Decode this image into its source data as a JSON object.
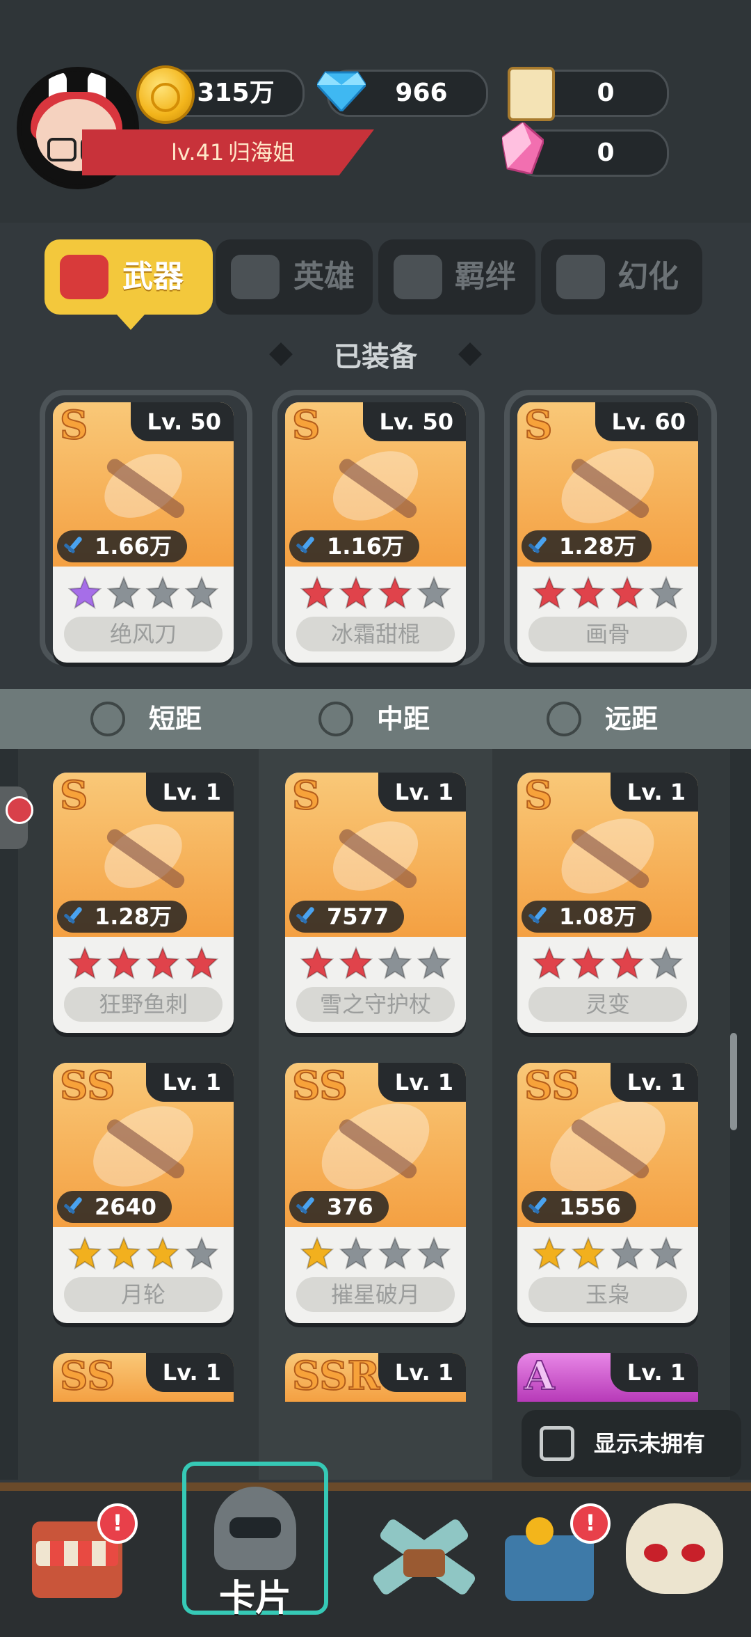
{
  "header": {
    "gold": "315万",
    "diamonds": "966",
    "scrolls": "0",
    "crystals": "0",
    "player_level": "lv.41",
    "player_name": "归海姐"
  },
  "tabs": [
    {
      "label": "武器",
      "active": true
    },
    {
      "label": "英雄",
      "active": false
    },
    {
      "label": "羁绊",
      "active": false
    },
    {
      "label": "幻化",
      "active": false
    }
  ],
  "equipped_title": "已装备",
  "equipped": [
    {
      "grade": "S",
      "level": "Lv. 50",
      "power": "1.66万",
      "stars_filled": 1,
      "star_color": "purple",
      "name": "绝风刀"
    },
    {
      "grade": "S",
      "level": "Lv. 50",
      "power": "1.16万",
      "stars_filled": 3,
      "star_color": "red",
      "name": "冰霜甜棍"
    },
    {
      "grade": "S",
      "level": "Lv. 60",
      "power": "1.28万",
      "stars_filled": 3,
      "star_color": "red",
      "name": "画骨"
    }
  ],
  "ranges": [
    "短距",
    "中距",
    "远距"
  ],
  "weapons": [
    {
      "grade": "S",
      "level": "Lv. 1",
      "power": "1.28万",
      "stars_filled": 4,
      "star_color": "red",
      "name": "狂野鱼刺"
    },
    {
      "grade": "S",
      "level": "Lv. 1",
      "power": "7577",
      "stars_filled": 2,
      "star_color": "red",
      "name": "雪之守护杖"
    },
    {
      "grade": "S",
      "level": "Lv. 1",
      "power": "1.08万",
      "stars_filled": 3,
      "star_color": "red",
      "name": "灵变"
    },
    {
      "grade": "SS",
      "level": "Lv. 1",
      "power": "2640",
      "stars_filled": 3,
      "star_color": "gold",
      "name": "月轮"
    },
    {
      "grade": "SS",
      "level": "Lv. 1",
      "power": "376",
      "stars_filled": 1,
      "star_color": "gold",
      "name": "摧星破月"
    },
    {
      "grade": "SS",
      "level": "Lv. 1",
      "power": "1556",
      "stars_filled": 2,
      "star_color": "gold",
      "name": "玉枭"
    }
  ],
  "partial_cards": [
    {
      "grade": "SS",
      "level": "Lv. 1"
    },
    {
      "grade": "SSR",
      "level": "Lv. 1"
    },
    {
      "grade": "A",
      "level": "Lv. 1"
    }
  ],
  "show_unowned_label": "显示未拥有",
  "bottom_nav": {
    "cards_label": "卡片",
    "shop_badge": "!",
    "chest_badge": "!"
  },
  "colors": {
    "star_red": "#e0434b",
    "star_gold": "#f2b01e",
    "star_purple": "#a66ee8",
    "star_empty": "#8a9196",
    "tab_active": "#f3c83c"
  }
}
